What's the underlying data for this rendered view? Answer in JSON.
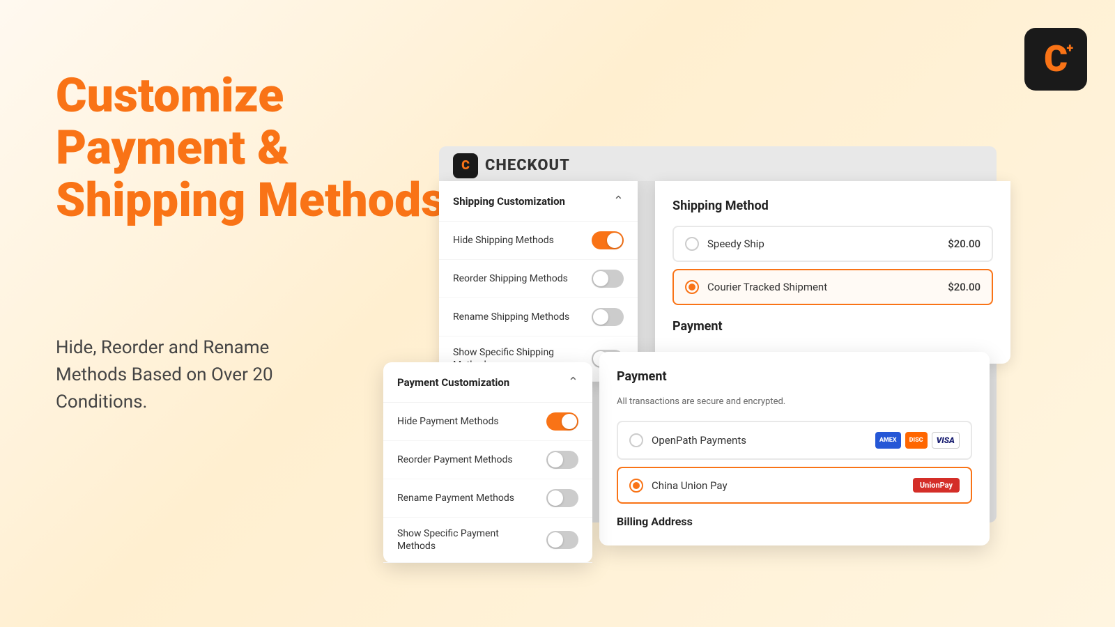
{
  "logo": {
    "letter": "C",
    "plus": "+",
    "checkout_text": "CHECKOUT"
  },
  "hero": {
    "title_line1": "Customize",
    "title_line2": "Payment &",
    "title_line3": "Shipping Methods",
    "subtitle": "Hide, Reorder and Rename Methods Based on Over 20 Conditions."
  },
  "shipping_panel": {
    "title": "Shipping Customization",
    "items": [
      {
        "label": "Hide Shipping Methods",
        "toggle": "on"
      },
      {
        "label": "Reorder Shipping Methods",
        "toggle": "off"
      },
      {
        "label": "Rename Shipping Methods",
        "toggle": "off"
      },
      {
        "label": "Show Specific Shipping Methods",
        "toggle": "off"
      }
    ]
  },
  "shipping_method_panel": {
    "title": "Shipping Method",
    "options": [
      {
        "name": "Speedy Ship",
        "price": "$20.00",
        "selected": false
      },
      {
        "name": "Courier Tracked Shipment",
        "price": "$20.00",
        "selected": true
      }
    ],
    "payment_title": "Payment"
  },
  "payment_panel": {
    "title": "Payment Customization",
    "items": [
      {
        "label": "Hide Payment Methods",
        "toggle": "on"
      },
      {
        "label": "Reorder Payment Methods",
        "toggle": "off"
      },
      {
        "label": "Rename Payment Methods",
        "toggle": "off"
      },
      {
        "label": "Show Specific Payment Methods",
        "toggle": "off"
      }
    ]
  },
  "payment_method_panel": {
    "title": "Payment",
    "subtitle": "All transactions are secure and encrypted.",
    "options": [
      {
        "name": "OpenPath Payments",
        "selected": false,
        "cards": [
          "AMEX",
          "DISC",
          "VISA"
        ]
      },
      {
        "name": "China Union Pay",
        "selected": true,
        "cards": [
          "UnionPay"
        ]
      }
    ],
    "billing_title": "Billing Address"
  }
}
